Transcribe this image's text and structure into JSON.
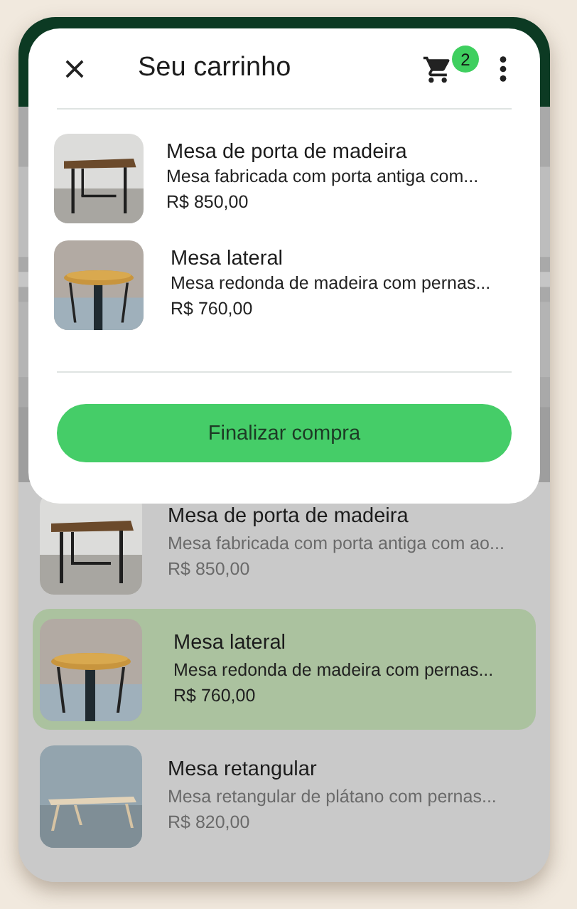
{
  "cart": {
    "title": "Seu carrinho",
    "badge": "2",
    "items": [
      {
        "name": "Mesa de porta de madeira",
        "description": "Mesa fabricada com porta antiga com...",
        "price": "R$ 850,00"
      },
      {
        "name": "Mesa lateral",
        "description": "Mesa redonda de madeira com pernas...",
        "price": "R$ 760,00"
      }
    ],
    "checkout": "Finalizar compra"
  },
  "products": [
    {
      "name": "Mesa de porta de madeira",
      "description": "Mesa fabricada com porta antiga com ao...",
      "price": "R$ 850,00",
      "selected": false
    },
    {
      "name": "Mesa lateral",
      "description": "Mesa redonda de madeira com pernas...",
      "price": "R$ 760,00",
      "selected": true
    },
    {
      "name": "Mesa retangular",
      "description": "Mesa retangular de plátano com pernas...",
      "price": "R$ 820,00",
      "selected": false
    }
  ]
}
